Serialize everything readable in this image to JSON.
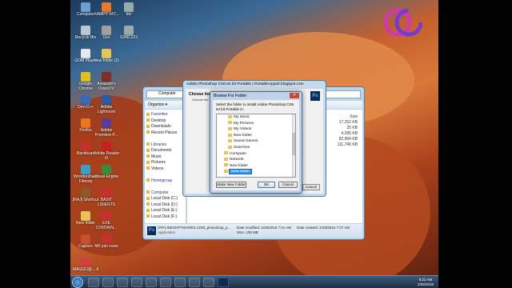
{
  "desktop": {
    "icons_left": [
      {
        "label": "Computer",
        "color": "#6aa0d8"
      },
      {
        "label": "Recycle Bin",
        "color": "#b8c8d8"
      },
      {
        "label": "GOM Player",
        "color": "#e8e8e8"
      },
      {
        "label": "Google Chrome",
        "color": "#e0c020"
      },
      {
        "label": "Dev-C++",
        "color": "#3868b8"
      },
      {
        "label": "Firefox",
        "color": "#e87820"
      },
      {
        "label": "Bandicam",
        "color": "#c83030"
      },
      {
        "label": "Wondershare Filmora",
        "color": "#3aa0c8"
      },
      {
        "label": "[RAJ] Shortcut",
        "color": "#8a5a2a"
      },
      {
        "label": "New folder",
        "color": "#e8c35a"
      },
      {
        "label": "Capture",
        "color": "#c85030"
      },
      {
        "label": "MAGGU@... II",
        "color": "#d04040"
      }
    ],
    "icons_right": [
      {
        "label": "XAMPP 64T...",
        "color": "#ea7a2a"
      },
      {
        "label": "Uzo",
        "color": "#a0a0a0"
      },
      {
        "label": "New folder (2)",
        "color": "#e8c35a"
      },
      {
        "label": "Assassin's Creed IV",
        "color": "#803020"
      },
      {
        "label": "Adobe Lightroom",
        "color": "#2a5aa0"
      },
      {
        "label": "Adobe Premiere P...",
        "color": "#5a3a9a"
      },
      {
        "label": "Adobe Reader XI",
        "color": "#c82020"
      },
      {
        "label": "Cheat Engine",
        "color": "#3a8a3a"
      },
      {
        "label": "BASIT LISIENTS",
        "color": "#c83030"
      },
      {
        "label": "EXE CONTAIN...",
        "color": "#c83030"
      },
      {
        "label": "MK join room",
        "color": "#c83030"
      }
    ],
    "icons_col3": [
      {
        "label": "bin",
        "color": "#9aa"
      },
      {
        "label": "S2MC223",
        "color": "#9aa"
      }
    ]
  },
  "explorer": {
    "address": "Computer",
    "toolbar_label": "Organize ▾",
    "nav_items": [
      {
        "label": "Favorites",
        "head": true
      },
      {
        "label": "Desktop",
        "head": false
      },
      {
        "label": "Downloads",
        "head": false
      },
      {
        "label": "Recent Places",
        "head": false
      },
      {
        "label": "",
        "head": false
      },
      {
        "label": "Libraries",
        "head": true
      },
      {
        "label": "Documents",
        "head": false
      },
      {
        "label": "Music",
        "head": false
      },
      {
        "label": "Pictures",
        "head": false
      },
      {
        "label": "Videos",
        "head": false
      },
      {
        "label": "",
        "head": false
      },
      {
        "label": "Homegroup",
        "head": true
      },
      {
        "label": "",
        "head": false
      },
      {
        "label": "Computer",
        "head": true
      },
      {
        "label": "Local Disk (C:)",
        "head": false
      },
      {
        "label": "Local Disk (D:)",
        "head": false
      },
      {
        "label": "Local Disk (E:)",
        "head": false
      },
      {
        "label": "Local Disk (F:)",
        "head": false
      }
    ],
    "size_header": "Size",
    "sizes": [
      "17,252 KB",
      "25 KB",
      "4,095 KB",
      "82,964 KB",
      "111,746 KB"
    ],
    "status": {
      "filename": "OFFLINESOFTWARES.COM_photoshop_p...",
      "type": "Application",
      "modified": "Date modified: 2/28/2016 7:41 AM",
      "created": "Date created: 2/28/2016 7:37 AM",
      "size": "Size: 109 MB"
    }
  },
  "installer": {
    "title": "Adobe Photoshop CS6 64 bit Portable | PortableAppsZ.blogspot.com",
    "heading": "Choose Ins",
    "sub": "Choose the",
    "cancel_label": "Cancel"
  },
  "browse": {
    "title": "Browse For Folder",
    "close_label": "✕",
    "instruction": "Select the folder to install Adobe Photoshop CS6 64 bit Portable in:",
    "tree": [
      {
        "label": "My Music",
        "indent": 2,
        "selected": false
      },
      {
        "label": "My Pictures",
        "indent": 2,
        "selected": false
      },
      {
        "label": "My Videos",
        "indent": 2,
        "selected": false
      },
      {
        "label": "New folder",
        "indent": 2,
        "selected": false
      },
      {
        "label": "Saved Games",
        "indent": 2,
        "selected": false
      },
      {
        "label": "Searches",
        "indent": 2,
        "selected": false
      },
      {
        "label": "Computer",
        "indent": 1,
        "selected": false
      },
      {
        "label": "Network",
        "indent": 1,
        "selected": false
      },
      {
        "label": "New folder",
        "indent": 1,
        "selected": false
      },
      {
        "label": "New folder",
        "indent": 1,
        "selected": true
      }
    ],
    "make_new_folder_label": "Make New Folder",
    "ok_label": "OK",
    "cancel_label": "Cancel"
  },
  "taskbar": {
    "time": "8:22 AM",
    "date": "2/28/2016"
  },
  "logo": {
    "letters": "GC",
    "colors": [
      "#d03aa8",
      "#7a3ad0"
    ]
  }
}
